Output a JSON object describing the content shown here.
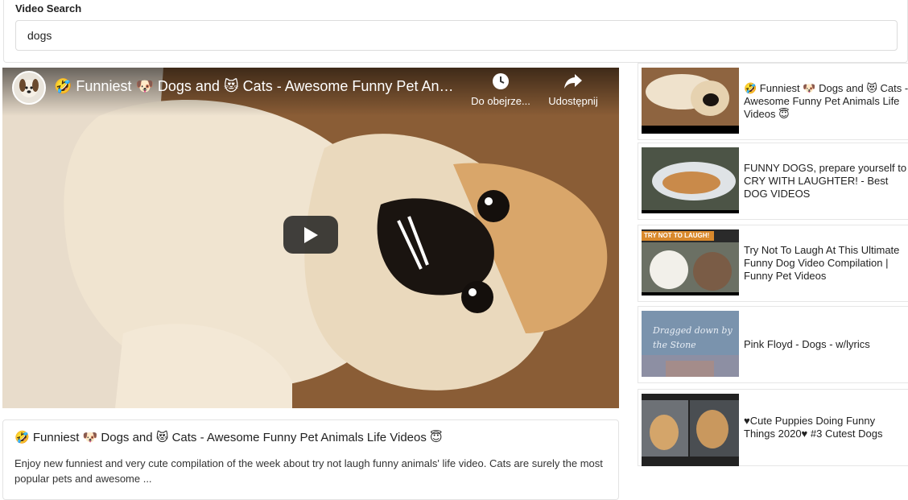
{
  "search": {
    "label": "Video Search",
    "value": "dogs"
  },
  "player": {
    "title": "🤣 Funniest 🐶 Dogs and 😻 Cats - Awesome Funny Pet Animals Life Videos 😇",
    "watch_later_label": "Do obejrze...",
    "share_label": "Udostępnij",
    "icons": {
      "watch_later": "clock-icon",
      "share": "share-arrow-icon",
      "play": "play-icon"
    }
  },
  "description": {
    "title": "🤣 Funniest 🐶 Dogs and 😻 Cats - Awesome Funny Pet Animals Life Videos 😇",
    "text": "Enjoy new funniest and very cute compilation of the week about try not laugh funny animals' life video. Cats are surely the most popular pets and awesome ..."
  },
  "related": [
    {
      "title": "🤣 Funniest 🐶 Dogs and 😻 Cats - Awesome Funny Pet Animals Life Videos 😇"
    },
    {
      "title": "FUNNY DOGS, prepare yourself to CRY WITH LAUGHTER! - Best DOG VIDEOS"
    },
    {
      "title": "Try Not To Laugh At This Ultimate Funny Dog Video Compilation | Funny Pet Videos",
      "thumb_banner": "TRY NOT TO LAUGH!"
    },
    {
      "title": "Pink Floyd - Dogs - w/lyrics",
      "thumb_overlay": "Dragged down by the Stone"
    },
    {
      "title": "♥Cute Puppies Doing Funny Things 2020♥ #3 Cutest Dogs"
    }
  ]
}
